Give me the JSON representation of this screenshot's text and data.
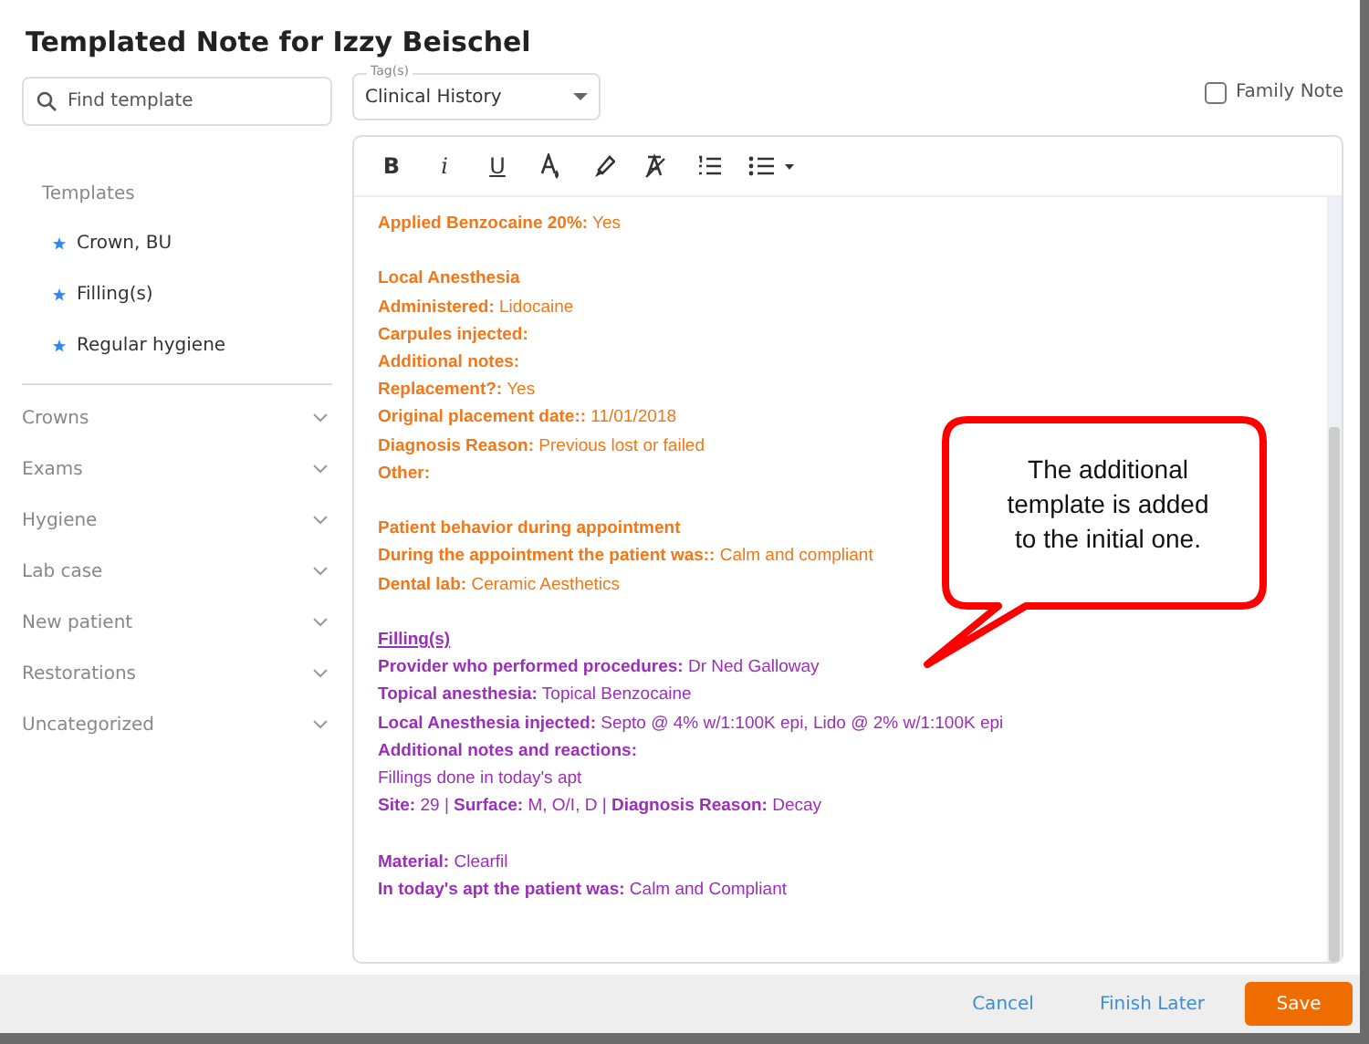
{
  "dialog": {
    "title": "Templated Note for Izzy Beischel"
  },
  "search": {
    "placeholder": "Find template"
  },
  "tag_select": {
    "label": "Tag(s)",
    "value": "Clinical History"
  },
  "family_note": {
    "label": "Family Note",
    "checked": false
  },
  "favorites": {
    "heading": "Templates",
    "items": [
      {
        "label": "Crown, BU"
      },
      {
        "label": "Filling(s)"
      },
      {
        "label": "Regular hygiene"
      }
    ]
  },
  "categories": [
    {
      "label": "Crowns",
      "expanded": false
    },
    {
      "label": "Exams",
      "expanded": false
    },
    {
      "label": "Hygiene",
      "expanded": false
    },
    {
      "label": "Lab case",
      "expanded": false
    },
    {
      "label": "New patient",
      "expanded": false
    },
    {
      "label": "Restorations",
      "expanded": false
    },
    {
      "label": "Uncategorized",
      "expanded": false
    }
  ],
  "toolbar": [
    {
      "kind": "bold",
      "label": "B"
    },
    {
      "kind": "italic",
      "label": "i"
    },
    {
      "kind": "underline",
      "label": "U"
    },
    {
      "kind": "text-color"
    },
    {
      "kind": "highlight"
    },
    {
      "kind": "clear-format"
    },
    {
      "kind": "numbered-list"
    },
    {
      "kind": "bullet-list"
    }
  ],
  "note_sections": [
    {
      "color": "#f07818",
      "blocks": [
        [
          "**Applied Benzocaine 20%:** Yes"
        ],
        [
          "**Local Anesthesia**",
          "**Administered:** Lidocaine",
          "**Carpules injected:**",
          "**Additional notes:**",
          "**Replacement?:** Yes",
          "**Original placement date::** 11/01/2018",
          "**Diagnosis Reason:** Previous lost or failed",
          "**Other:**"
        ],
        [
          "**Patient behavior during appointment**",
          "**During the appointment the patient was::** Calm and compliant",
          "**Dental lab:** Ceramic Aesthetics"
        ]
      ]
    },
    {
      "color": "#9b30b8",
      "heading": "Filling(s)",
      "blocks": [
        [
          "**Provider who performed procedures:** Dr Ned Galloway",
          "**Topical anesthesia:** Topical Benzocaine",
          "**Local Anesthesia injected:** Septo @ 4% w/1:100K epi, Lido @ 2% w/1:100K epi",
          "**Additional notes and reactions:**",
          "Fillings done in today's apt",
          "**Site:** 29 | **Surface:** M, O/I, D | **Diagnosis Reason:** Decay"
        ],
        [
          "**Material:** Clearfil",
          "**In today's apt the patient was:** Calm and Compliant"
        ]
      ]
    }
  ],
  "callout": {
    "text": "The additional template is added to the initial one."
  },
  "footer": {
    "buttons": [
      {
        "label": "Cancel",
        "kind": "link"
      },
      {
        "label": "Finish Later",
        "kind": "link"
      },
      {
        "label": "Save",
        "kind": "primary"
      }
    ]
  }
}
